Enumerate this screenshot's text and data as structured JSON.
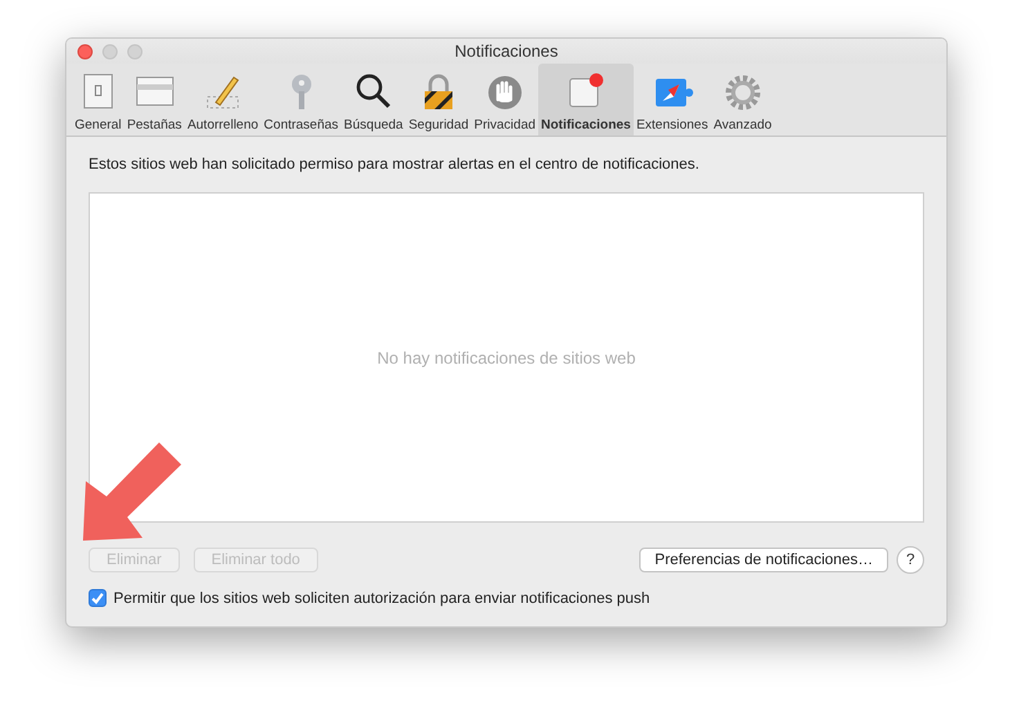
{
  "window": {
    "title": "Notificaciones"
  },
  "tabs": [
    {
      "label": "General",
      "selected": false
    },
    {
      "label": "Pestañas",
      "selected": false
    },
    {
      "label": "Autorrelleno",
      "selected": false
    },
    {
      "label": "Contraseñas",
      "selected": false
    },
    {
      "label": "Búsqueda",
      "selected": false
    },
    {
      "label": "Seguridad",
      "selected": false
    },
    {
      "label": "Privacidad",
      "selected": false
    },
    {
      "label": "Notificaciones",
      "selected": true
    },
    {
      "label": "Extensiones",
      "selected": false
    },
    {
      "label": "Avanzado",
      "selected": false
    }
  ],
  "description": "Estos sitios web han solicitado permiso para mostrar alertas en el centro de notificaciones.",
  "list": {
    "empty_message": "No hay notificaciones de sitios web"
  },
  "buttons": [
    {
      "label": "Eliminar",
      "disabled": true
    },
    {
      "label": "Eliminar todo",
      "disabled": true
    }
  ],
  "preferences_button": {
    "label": "Preferencias de notificaciones…",
    "disabled": false
  },
  "help_button": {
    "label": "?"
  },
  "push_checkbox": {
    "label": "Permitir que los sitios web soliciten autorización para enviar notificaciones push",
    "checked": true
  }
}
